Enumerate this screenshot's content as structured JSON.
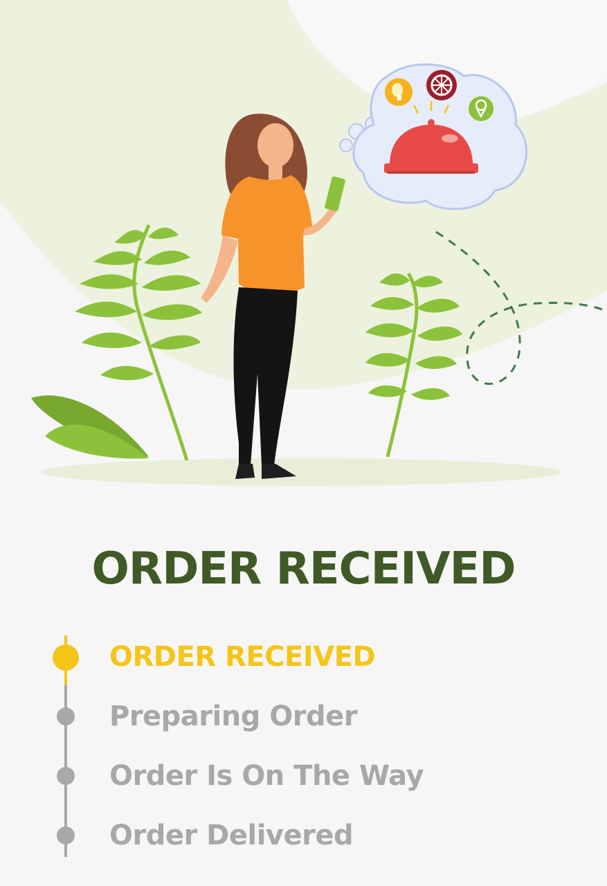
{
  "screen": {
    "title": "ORDER RECEIVED"
  },
  "progress": {
    "current_step_index": 0,
    "steps": [
      {
        "label": "ORDER RECEIVED",
        "state": "active"
      },
      {
        "label": "Preparing Order",
        "state": "pending"
      },
      {
        "label": "Order Is On The Way",
        "state": "pending"
      },
      {
        "label": "Order Delivered",
        "state": "pending"
      }
    ]
  },
  "colors": {
    "title": "#3f5a26",
    "active": "#f5c518",
    "pending": "#a8a8a8",
    "background": "#f6f6f6",
    "accent_green": "#8fc13a"
  },
  "illustration": {
    "subject": "woman-holding-phone",
    "thought_bubble_icons": [
      "cloche-icon",
      "drumstick-icon",
      "pizza-icon",
      "ice-cream-icon"
    ]
  }
}
